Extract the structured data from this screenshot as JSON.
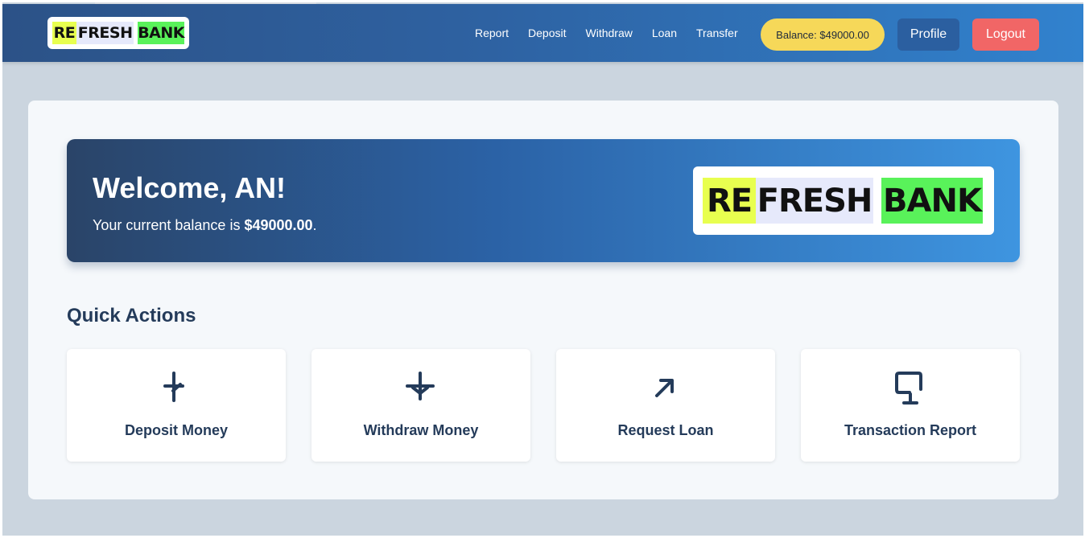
{
  "brand": {
    "logo_re": "RE",
    "logo_fresh": "FRESH",
    "logo_bank": "BANK"
  },
  "nav": {
    "links": [
      "Report",
      "Deposit",
      "Withdraw",
      "Loan",
      "Transfer"
    ],
    "balance_label": "Balance: $49000.00",
    "profile_label": "Profile",
    "logout_label": "Logout"
  },
  "welcome": {
    "title": "Welcome, AN!",
    "balance_prefix": "Your current balance is ",
    "balance_value": "$49000.00",
    "balance_suffix": "."
  },
  "quick_actions": {
    "title": "Quick Actions",
    "items": [
      {
        "label": "Deposit Money",
        "icon": "deposit-icon"
      },
      {
        "label": "Withdraw Money",
        "icon": "withdraw-icon"
      },
      {
        "label": "Request Loan",
        "icon": "arrow-up-right-icon"
      },
      {
        "label": "Transaction Report",
        "icon": "report-icon"
      }
    ]
  },
  "colors": {
    "nav_start": "#2c5287",
    "nav_end": "#3182ce",
    "balance_pill": "#f6d859",
    "profile_button": "#2b5fa0",
    "logout_button": "#f16666",
    "heading_text": "#243b5a"
  }
}
